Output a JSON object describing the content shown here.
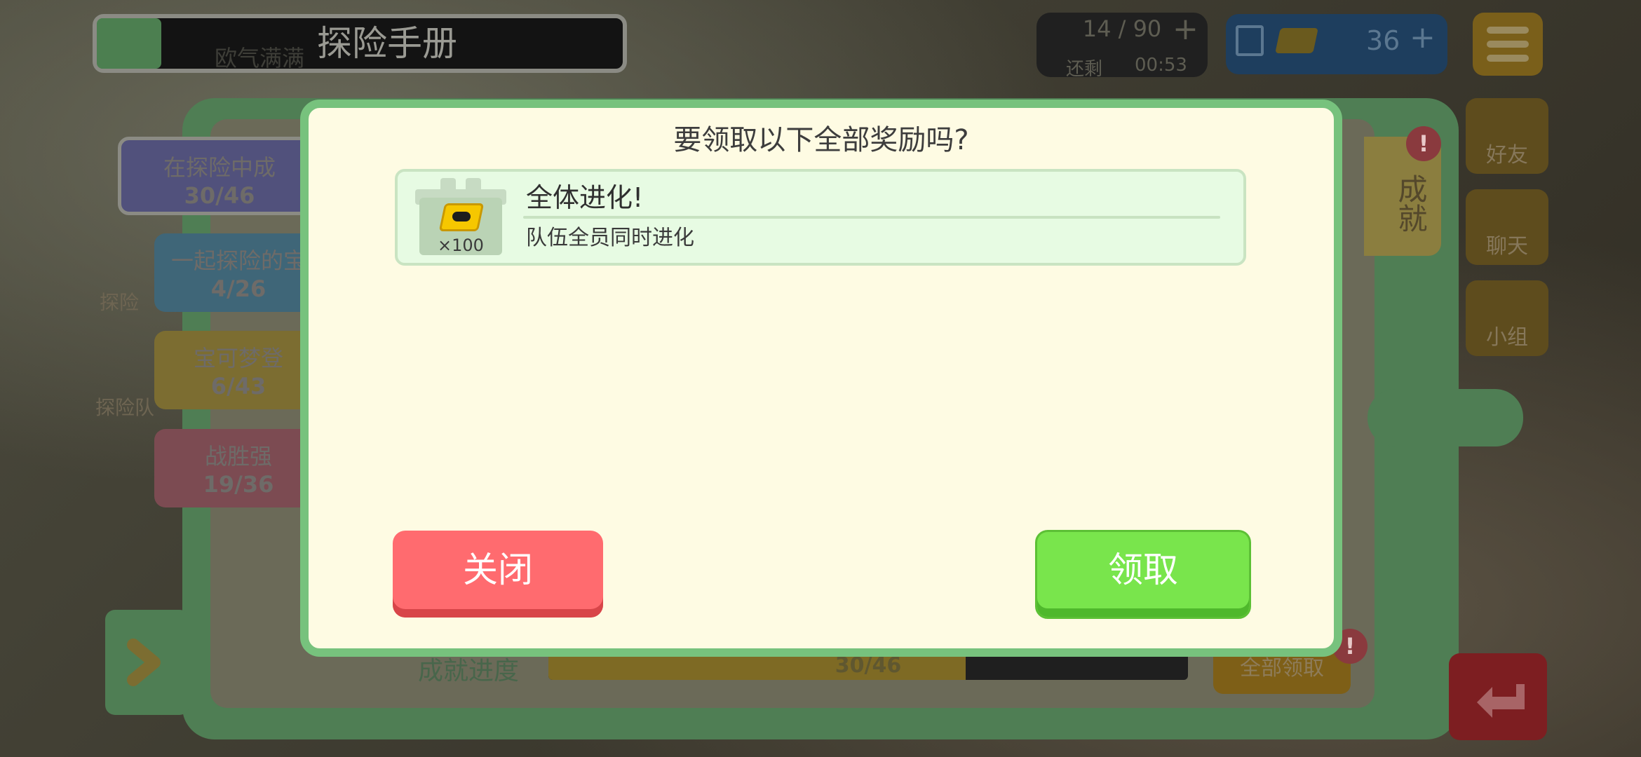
{
  "background": {
    "title": "探险手册",
    "title_sub": "欧气满满",
    "stamina": "14 / 90",
    "timer_label": "还剩",
    "timer": "00:53",
    "ticket_count": "36",
    "side_buttons": [
      "好友",
      "聊天",
      "小组"
    ],
    "left_labels": [
      "探险",
      "探险队"
    ],
    "tab_label": "成就",
    "categories": [
      {
        "label": "在探险中成",
        "count": "30/46"
      },
      {
        "label": "一起探险的宝",
        "count": "4/26"
      },
      {
        "label": "宝可梦登",
        "count": "6/43"
      },
      {
        "label": "战胜强",
        "count": "19/36"
      }
    ],
    "progress_label": "成就进度",
    "progress_text": "30/46",
    "progress_fraction": 0.652,
    "claim_all": "全部领取",
    "alert": "!"
  },
  "dialog": {
    "title": "要领取以下全部奖励吗?",
    "reward": {
      "name": "全体进化!",
      "description": "队伍全员同时进化",
      "quantity": "×100",
      "icon": "ticket-icon"
    },
    "close_label": "关闭",
    "claim_label": "领取"
  },
  "colors": {
    "dialog_border": "#77c27d",
    "dialog_bg": "#fefbe3",
    "close_button": "#ff6b6f",
    "claim_button": "#79e54c"
  }
}
